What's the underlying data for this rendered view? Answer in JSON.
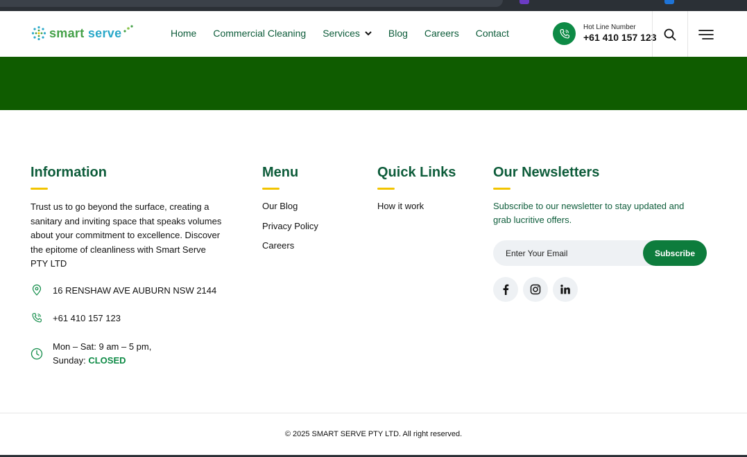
{
  "brand": {
    "name_part1": "smart",
    "name_part2": "serve",
    "green": "#43a047",
    "blue": "#29a8c9"
  },
  "nav": {
    "items": [
      {
        "label": "Home"
      },
      {
        "label": "Commercial Cleaning"
      },
      {
        "label": "Services"
      },
      {
        "label": "Blog"
      },
      {
        "label": "Careers"
      },
      {
        "label": "Contact"
      }
    ]
  },
  "hotline": {
    "label": "Hot Line Number",
    "number": "+61 410 157 123",
    "icon": "phone-icon"
  },
  "colors": {
    "banner": "#0f5c00",
    "accent": "#0d8a45",
    "title": "#0d5c3a",
    "underline": "#f2c400"
  },
  "information": {
    "title": "Information",
    "description": "Trust us to go beyond the surface, creating a sanitary and inviting space that speaks volumes about your commitment to excellence. Discover the epitome of cleanliness with Smart Serve PTY LTD",
    "address": "16 RENSHAW AVE AUBURN NSW 2144",
    "phone": "+61 410 157 123",
    "hours_weekday": "Mon – Sat: 9 am – 5 pm,",
    "hours_sunday_label": "Sunday: ",
    "hours_sunday_value": "CLOSED"
  },
  "menu": {
    "title": "Menu",
    "links": [
      {
        "label": "Our Blog"
      },
      {
        "label": "Privacy Policy"
      },
      {
        "label": "Careers"
      }
    ]
  },
  "quick_links": {
    "title": "Quick Links",
    "links": [
      {
        "label": "How it work"
      }
    ]
  },
  "newsletter": {
    "title": "Our Newsletters",
    "description": "Subscribe to our newsletter to stay updated and grab lucritive offers.",
    "email_placeholder": "Enter Your Email",
    "subscribe_label": "Subscribe",
    "socials": [
      "facebook-icon",
      "instagram-icon",
      "linkedin-icon"
    ]
  },
  "copyright": "© 2025 SMART SERVE PTY LTD. All right reserved."
}
